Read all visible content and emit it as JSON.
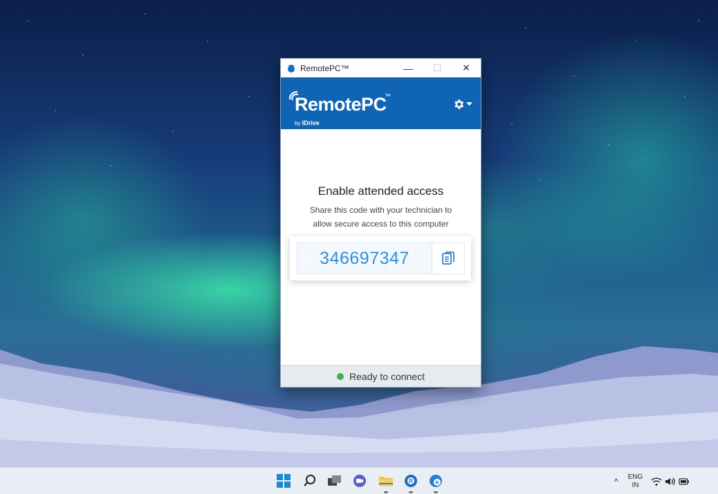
{
  "window": {
    "title": "RemotePC™",
    "controls": {
      "minimize": "—",
      "maximize": "☐",
      "close": "✕"
    }
  },
  "brand": {
    "name": "RemotePC",
    "trademark": "™",
    "byline_prefix": "by",
    "byline_brand": "IDrive",
    "color": "#0f65b4"
  },
  "settings": {
    "icon": "gear-icon",
    "dropdown_icon": "caret-down-icon"
  },
  "main": {
    "heading": "Enable attended access",
    "description_line1": "Share this code with your technician to",
    "description_line2": "allow secure access to this computer",
    "access_code": "346697347",
    "copy_icon": "copy-icon",
    "code_color": "#2f8fd3"
  },
  "status": {
    "text": "Ready to connect",
    "dot_color": "#3fb04a"
  },
  "taskbar": {
    "icons": [
      "windows-start-icon",
      "search-icon",
      "task-view-icon",
      "chat-icon",
      "file-explorer-icon",
      "remotepc-icon",
      "remotepc-alt-icon"
    ],
    "tray": {
      "chevron": "^",
      "language_line1": "ENG",
      "language_line2": "IN"
    }
  }
}
